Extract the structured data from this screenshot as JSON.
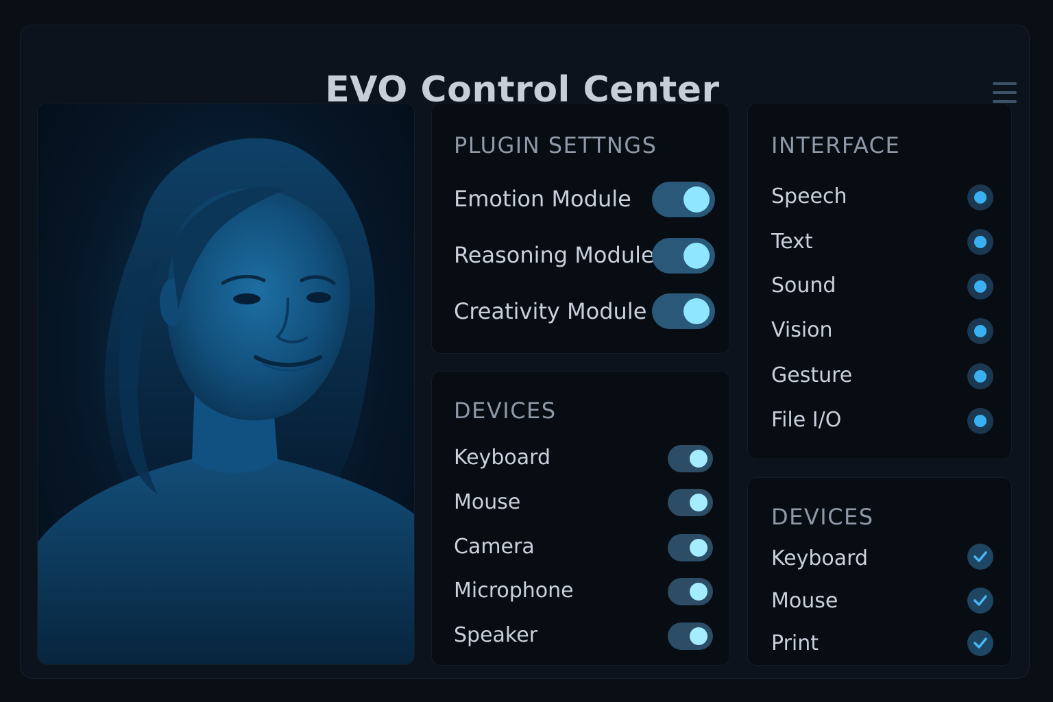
{
  "app": {
    "title": "EVO Control Center"
  },
  "header": {
    "menu_icon": "hamburger-menu-icon"
  },
  "portrait": {
    "image": "glowing blue digital human avatar portrait",
    "tint_color": "#0b3b63"
  },
  "plugin_settings": {
    "title": "PLUGIN SETTNGS",
    "items": [
      {
        "label": "Emotion Module",
        "enabled": true
      },
      {
        "label": "Reasoning Module",
        "enabled": true
      },
      {
        "label": "Creativity Module",
        "enabled": true
      }
    ]
  },
  "devices_toggles": {
    "title": "DEVICES",
    "items": [
      {
        "label": "Keyboard",
        "enabled": true
      },
      {
        "label": "Mouse",
        "enabled": true
      },
      {
        "label": "Camera",
        "enabled": true
      },
      {
        "label": "Microphone",
        "enabled": true
      },
      {
        "label": "Speaker",
        "enabled": true
      }
    ]
  },
  "interface": {
    "title": "INTERFACE",
    "items": [
      {
        "label": "Speech",
        "selected": true
      },
      {
        "label": "Text",
        "selected": true
      },
      {
        "label": "Sound",
        "selected": true
      },
      {
        "label": "Vision",
        "selected": true
      },
      {
        "label": "Gesture",
        "selected": true
      },
      {
        "label": "File I/O",
        "selected": true
      }
    ]
  },
  "devices_checks": {
    "title": "DEVICES",
    "items": [
      {
        "label": "Keyboard",
        "checked": true
      },
      {
        "label": "Mouse",
        "checked": true
      },
      {
        "label": "Print",
        "checked": true
      }
    ]
  },
  "colors": {
    "background": "#0a0e15",
    "panel": "#080c13",
    "accent": "#3ab0f2",
    "toggle_knob": "#8fe6ff",
    "toggle_track": "#2a5878"
  }
}
